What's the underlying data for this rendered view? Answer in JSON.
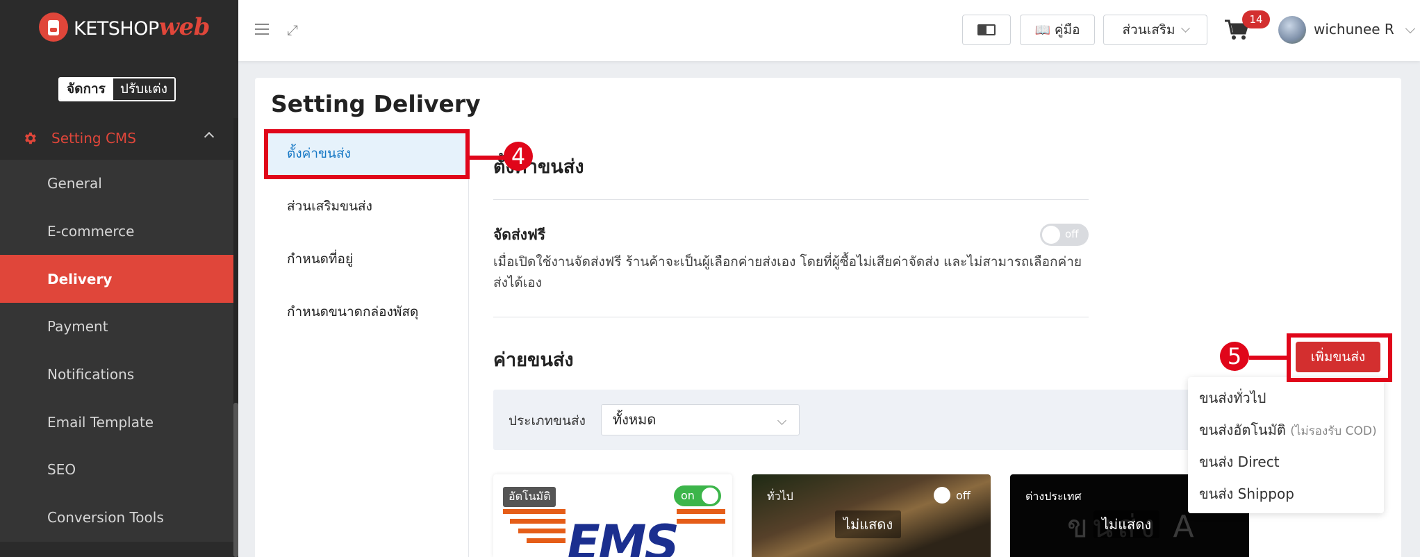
{
  "sidebar": {
    "logo_text": "KETSHOP",
    "logo_web": "web",
    "mode_manage": "จัดการ",
    "mode_customize": "ปรับแต่ง",
    "section_label": "Setting CMS",
    "items": [
      {
        "label": "General"
      },
      {
        "label": "E-commerce"
      },
      {
        "label": "Delivery"
      },
      {
        "label": "Payment"
      },
      {
        "label": "Notifications"
      },
      {
        "label": "Email Template"
      },
      {
        "label": "SEO"
      },
      {
        "label": "Conversion Tools"
      }
    ]
  },
  "topbar": {
    "guide_label": "คู่มือ",
    "extra_label": "ส่วนเสริม",
    "cart_count": "14",
    "user_name": "wichunee R"
  },
  "page": {
    "title": "Setting Delivery",
    "subnav": [
      {
        "label": "ตั้งค่าขนส่ง"
      },
      {
        "label": "ส่วนเสริมขนส่ง"
      },
      {
        "label": "กำหนดที่อยู่"
      },
      {
        "label": "กำหนดขนาดกล่องพัสดุ"
      }
    ],
    "section_title": "ตั้งค่าขนส่ง",
    "free_shipping_title": "จัดส่งฟรี",
    "free_shipping_toggle": "off",
    "free_shipping_desc": "เมื่อเปิดใช้งานจัดส่งฟรี ร้านค้าจะเป็นผู้เลือกค่ายส่งเอง โดยที่ผู้ซื้อไม่เสียค่าจัดส่ง และไม่สามารถเลือกค่ายส่งได้เอง",
    "carriers_title": "ค่ายขนส่ง",
    "add_button": "เพิ่มขนส่ง",
    "filter_label": "ประเภทขนส่ง",
    "filter_value": "ทั้งหมด",
    "dropdown": [
      {
        "label": "ขนส่งทั่วไป",
        "note": ""
      },
      {
        "label": "ขนส่งอัตโนมัติ",
        "note": "(ไม่รองรับ COD)"
      },
      {
        "label": "ขนส่ง Direct",
        "note": ""
      },
      {
        "label": "ขนส่ง Shippop",
        "note": ""
      }
    ],
    "carriers": [
      {
        "tag": "อัตโนมัติ",
        "logo": "EMS",
        "toggle": "on",
        "status": ""
      },
      {
        "tag": "ทั่วไป",
        "toggle": "off",
        "status": "ไม่แสดง"
      },
      {
        "tag": "ต่างประเทศ",
        "status": "ไม่แสดง",
        "ghost": "ขนส่ง A"
      }
    ]
  },
  "annotations": {
    "step4": "4",
    "step5": "5"
  },
  "colors": {
    "brand_red": "#e0463a",
    "annotation_red": "#e0061a",
    "active_subnav_blue": "#1577c4",
    "toggle_green": "#3cb54a"
  }
}
